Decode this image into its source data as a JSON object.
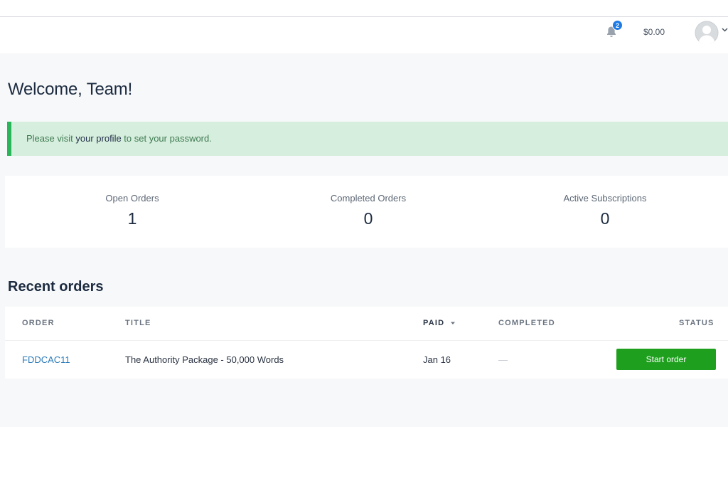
{
  "header": {
    "notifications_count": "2",
    "balance": "$0.00"
  },
  "welcome": "Welcome, Team!",
  "alert": {
    "prefix": "Please visit ",
    "link": "your profile",
    "suffix": " to set your password."
  },
  "stats": [
    {
      "label": "Open Orders",
      "value": "1"
    },
    {
      "label": "Completed Orders",
      "value": "0"
    },
    {
      "label": "Active Subscriptions",
      "value": "0"
    }
  ],
  "recent_orders": {
    "title": "Recent orders",
    "columns": {
      "order": "ORDER",
      "title": "TITLE",
      "paid": "PAID",
      "completed": "COMPLETED",
      "status": "STATUS"
    },
    "rows": [
      {
        "order": "FDDCAC11",
        "title": "The Authority Package - 50,000 Words",
        "paid": "Jan 16",
        "completed": "—",
        "status_button": "Start order"
      }
    ]
  },
  "colors": {
    "accent_green": "#1ea01e",
    "alert_bg": "#d6eedd",
    "alert_border": "#2bb55a",
    "link_blue": "#2a7ab8",
    "badge_blue": "#1e7be6"
  },
  "icons": {
    "notifications": "bell-icon",
    "avatar": "user-avatar-icon",
    "menu": "chevron-down-icon",
    "sort": "caret-down-icon"
  }
}
